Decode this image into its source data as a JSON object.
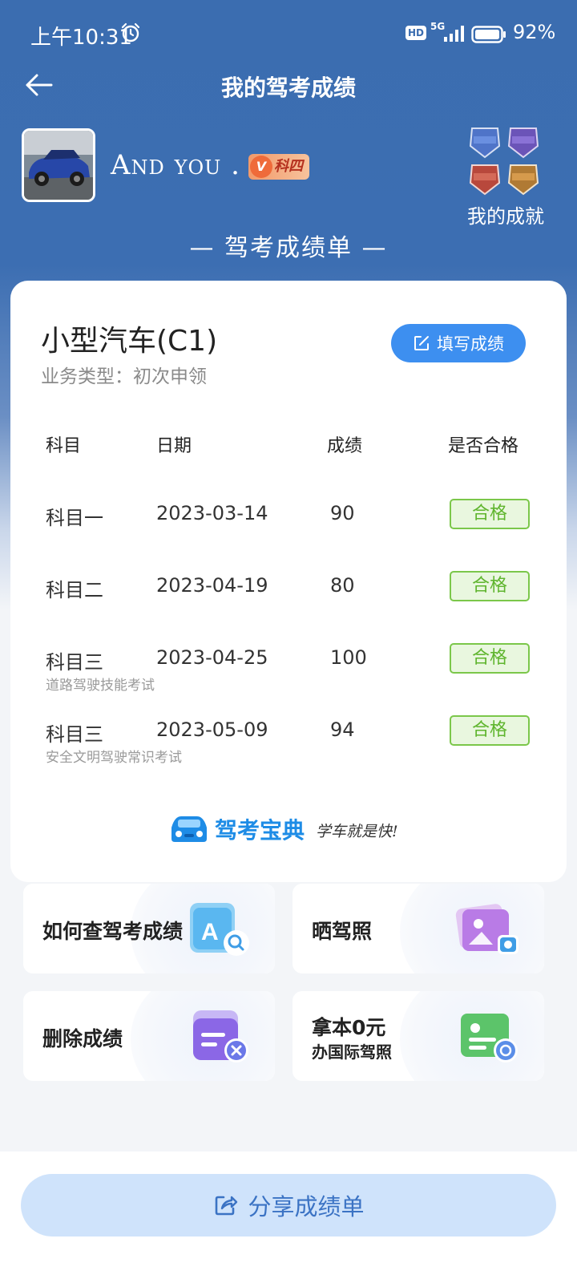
{
  "status_bar": {
    "time": "上午10:31",
    "hd": "HD",
    "network": "5G",
    "battery": "92%"
  },
  "header": {
    "title": "我的驾考成绩"
  },
  "profile": {
    "username": "And you .",
    "level_badge": "科四",
    "level_badge_letter": "V",
    "achievements_label": "我的成就"
  },
  "sheet_title": "— 驾考成绩单 —",
  "card": {
    "car_type": "小型汽车(C1)",
    "business_type": "业务类型：初次申领",
    "fill_button": "填写成绩",
    "columns": [
      "科目",
      "日期",
      "成绩",
      "是否合格"
    ],
    "rows": [
      {
        "subject": "科目一",
        "date": "2023-03-14",
        "score": "90",
        "status": "合格",
        "note": ""
      },
      {
        "subject": "科目二",
        "date": "2023-04-19",
        "score": "80",
        "status": "合格",
        "note": ""
      },
      {
        "subject": "科目三",
        "date": "2023-04-25",
        "score": "100",
        "status": "合格",
        "note": "道路驾驶技能考试"
      },
      {
        "subject": "科目三",
        "date": "2023-05-09",
        "score": "94",
        "status": "合格",
        "note": "安全文明驾驶常识考试"
      }
    ],
    "brand_name": "驾考宝典",
    "brand_slogan": "学车就是快!"
  },
  "tiles": {
    "query": "如何查驾考成绩",
    "show_license": "晒驾照",
    "delete": "删除成绩",
    "intl_line1": "拿本0元",
    "intl_line2": "办国际驾照"
  },
  "share_button": "分享成绩单",
  "colors": {
    "header_blue": "#3b6db0",
    "accent_blue": "#3d8ff0",
    "pass_green": "#5fb52e",
    "share_bg": "#cfe3fb"
  }
}
